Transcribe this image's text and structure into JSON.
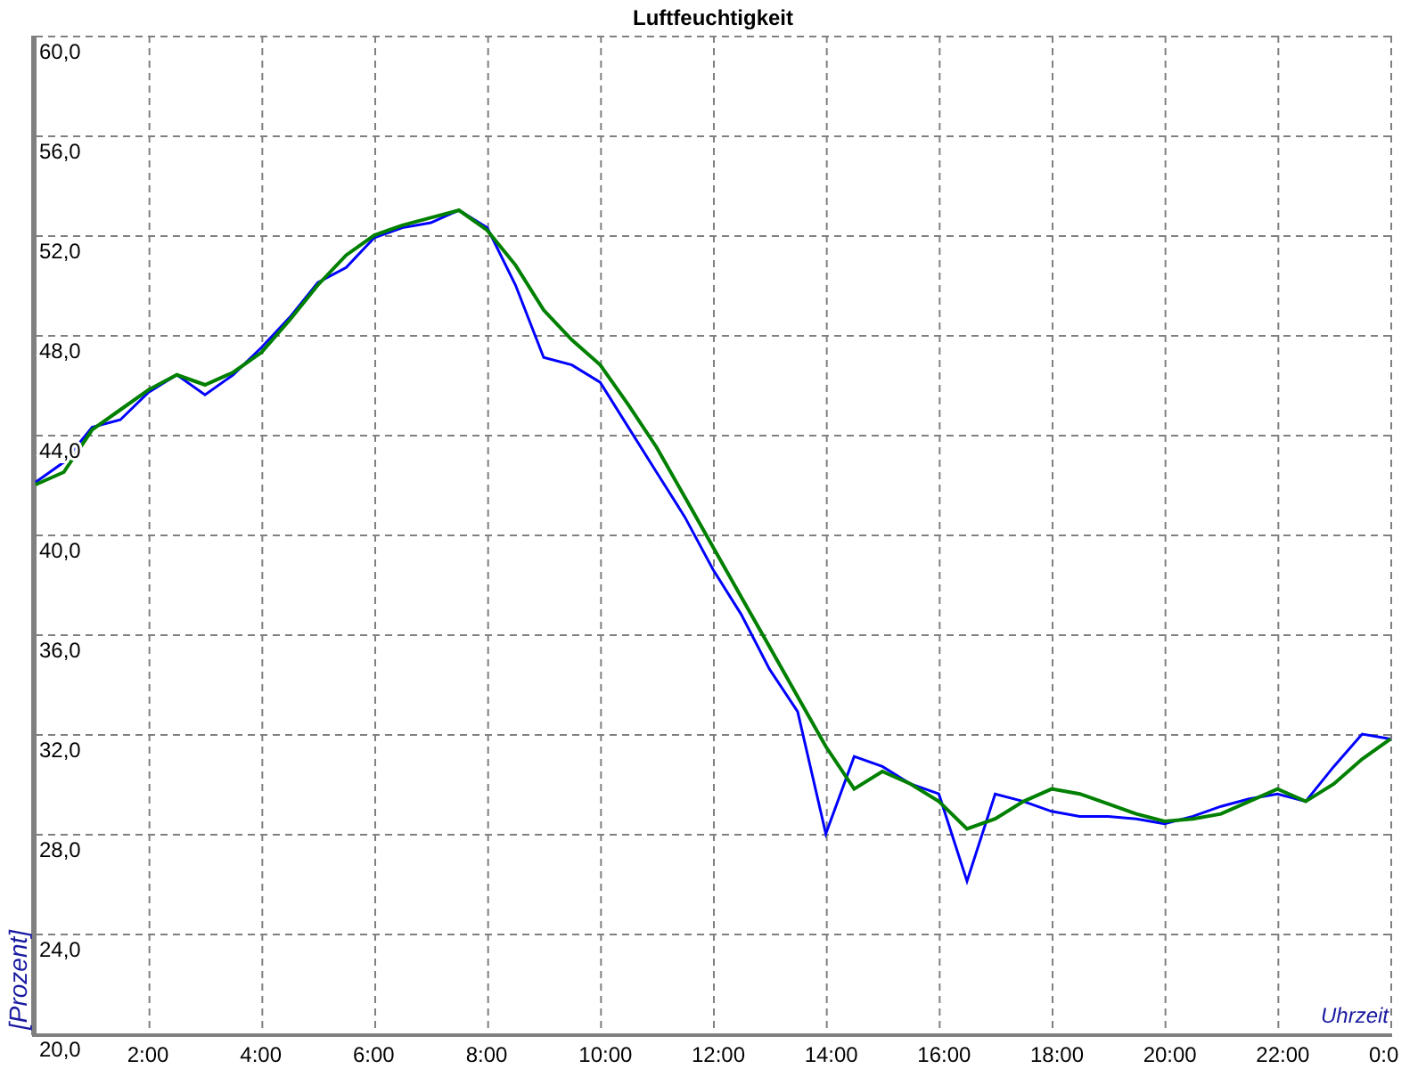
{
  "chart": {
    "chart_data": {
      "type": "line",
      "title": "Luftfeuchtigkeit",
      "xlabel": "Uhrzeit",
      "ylabel": "[Prozent]",
      "x": [
        0,
        0.5,
        1,
        1.5,
        2,
        2.5,
        3,
        3.5,
        4,
        4.5,
        5,
        5.5,
        6,
        6.5,
        7,
        7.5,
        8,
        8.5,
        9,
        9.5,
        10,
        10.5,
        11,
        11.5,
        12,
        12.5,
        13,
        13.5,
        14,
        14.5,
        15,
        15.5,
        16,
        16.5,
        17,
        17.5,
        18,
        18.5,
        19,
        19.5,
        20,
        20.5,
        21,
        21.5,
        22,
        22.5,
        23,
        23.5,
        24
      ],
      "series": [
        {
          "color": "#0000ff",
          "values": [
            42.1,
            42.9,
            44.3,
            44.6,
            45.7,
            46.4,
            45.6,
            46.4,
            47.5,
            48.7,
            50.1,
            50.7,
            51.9,
            52.3,
            52.5,
            53.0,
            52.3,
            50.0,
            47.1,
            46.8,
            46.1,
            44.3,
            42.5,
            40.7,
            38.6,
            36.8,
            34.6,
            32.9,
            28.0,
            31.1,
            30.7,
            30.0,
            29.6,
            26.1,
            29.6,
            29.3,
            28.9,
            28.7,
            28.7,
            28.6,
            28.4,
            28.7,
            29.1,
            29.4,
            29.6,
            29.3,
            30.7,
            32.0,
            31.8
          ]
        },
        {
          "color": "#008000",
          "values": [
            42.0,
            42.5,
            44.2,
            45.0,
            45.8,
            46.4,
            46.0,
            46.5,
            47.3,
            48.6,
            50.0,
            51.2,
            52.0,
            52.4,
            52.7,
            53.0,
            52.2,
            50.8,
            49.0,
            47.8,
            46.8,
            45.2,
            43.5,
            41.5,
            39.5,
            37.5,
            35.5,
            33.5,
            31.5,
            29.8,
            30.5,
            30.0,
            29.3,
            28.2,
            28.6,
            29.3,
            29.8,
            29.6,
            29.2,
            28.8,
            28.5,
            28.6,
            28.8,
            29.3,
            29.8,
            29.3,
            30.0,
            31.0,
            31.8
          ]
        }
      ],
      "grid": true,
      "xlim": [
        0,
        24
      ],
      "ylim": [
        20,
        60
      ],
      "xticks": [
        {
          "value": 2,
          "label": "2:00"
        },
        {
          "value": 4,
          "label": "4:00"
        },
        {
          "value": 6,
          "label": "6:00"
        },
        {
          "value": 8,
          "label": "8:00"
        },
        {
          "value": 10,
          "label": "10:00"
        },
        {
          "value": 12,
          "label": "12:00"
        },
        {
          "value": 14,
          "label": "14:00"
        },
        {
          "value": 16,
          "label": "16:00"
        },
        {
          "value": 18,
          "label": "18:00"
        },
        {
          "value": 20,
          "label": "20:00"
        },
        {
          "value": 22,
          "label": "22:00"
        },
        {
          "value": 24,
          "label": "0:0"
        }
      ],
      "yticks": [
        {
          "value": 20,
          "label": "20,0"
        },
        {
          "value": 24,
          "label": "24,0"
        },
        {
          "value": 28,
          "label": "28,0"
        },
        {
          "value": 32,
          "label": "32,0"
        },
        {
          "value": 36,
          "label": "36,0"
        },
        {
          "value": 40,
          "label": "40,0"
        },
        {
          "value": 44,
          "label": "44,0"
        },
        {
          "value": 48,
          "label": "48,0"
        },
        {
          "value": 52,
          "label": "52,0"
        },
        {
          "value": 56,
          "label": "56,0"
        },
        {
          "value": 60,
          "label": "60,0"
        }
      ]
    }
  }
}
